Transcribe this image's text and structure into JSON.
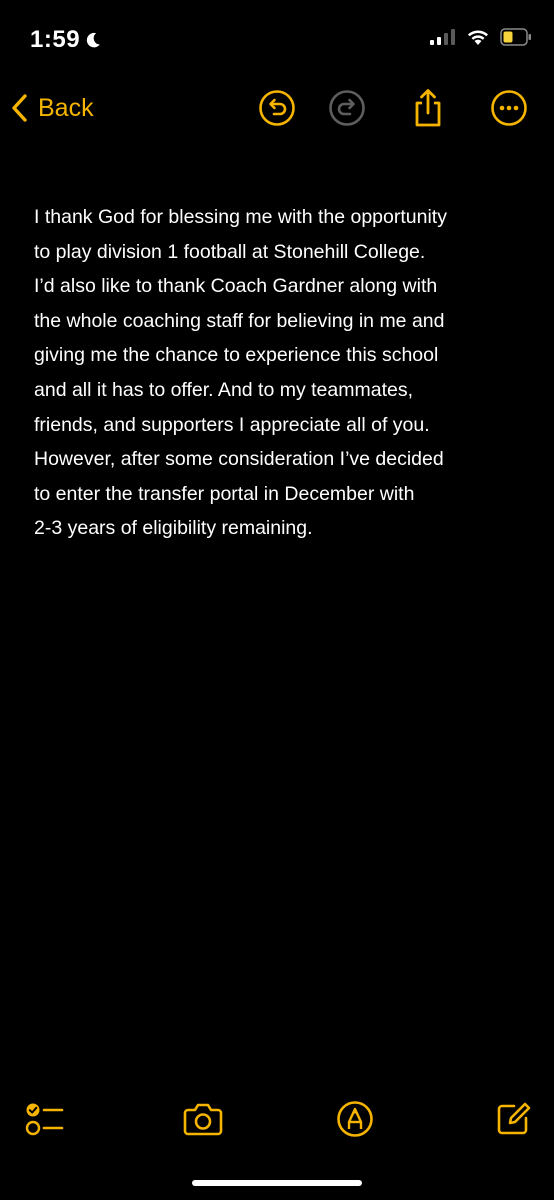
{
  "status_bar": {
    "time": "1:59",
    "focus_icon": "moon-icon",
    "signal_icon": "cellular-signal-icon",
    "wifi_icon": "wifi-icon",
    "battery_icon": "battery-low-power-icon",
    "battery_color": "#f7d33c"
  },
  "nav": {
    "back_label": "Back",
    "icons": [
      "undo-icon",
      "redo-icon",
      "share-icon",
      "more-icon"
    ],
    "accent_color": "#f5b400"
  },
  "note": {
    "lines": [
      "I thank God for blessing me with the opportunity",
      "to play division 1 football at Stonehill College.",
      "I’d also like to thank Coach Gardner along with",
      "the whole coaching staff for believing in me and",
      "giving me the chance to experience this school",
      "and all it has to offer. And to my teammates,",
      "friends, and supporters I appreciate all of you.",
      "However, after some consideration I’ve decided",
      "to enter the transfer portal in December with",
      "2-3 years of eligibility remaining."
    ]
  },
  "toolbar": {
    "icons": [
      "checklist-icon",
      "camera-icon",
      "markup-icon",
      "compose-icon"
    ]
  }
}
